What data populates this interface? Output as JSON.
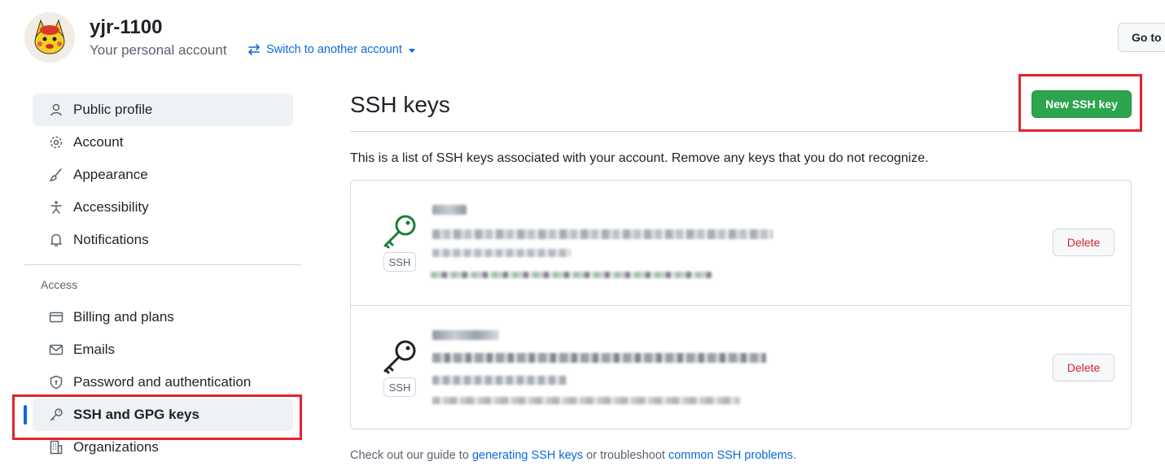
{
  "header": {
    "username": "yjr-1100",
    "subtitle": "Your personal account",
    "switch_label": "Switch to another account",
    "goto_label": "Go to"
  },
  "sidebar": {
    "items": [
      {
        "label": "Public profile",
        "icon": "person-icon"
      },
      {
        "label": "Account",
        "icon": "gear-icon"
      },
      {
        "label": "Appearance",
        "icon": "paintbrush-icon"
      },
      {
        "label": "Accessibility",
        "icon": "accessibility-icon"
      },
      {
        "label": "Notifications",
        "icon": "bell-icon"
      }
    ],
    "access_label": "Access",
    "access_items": [
      {
        "label": "Billing and plans",
        "icon": "credit-card-icon"
      },
      {
        "label": "Emails",
        "icon": "mail-icon"
      },
      {
        "label": "Password and authentication",
        "icon": "shield-lock-icon"
      },
      {
        "label": "SSH and GPG keys",
        "icon": "key-icon",
        "selected": true
      },
      {
        "label": "Organizations",
        "icon": "organization-icon"
      }
    ]
  },
  "main": {
    "title": "SSH keys",
    "new_button": "New SSH key",
    "description": "This is a list of SSH keys associated with your account. Remove any keys that you do not recognize.",
    "keys": [
      {
        "badge": "SSH",
        "delete_label": "Delete",
        "icon_color": "#1a7f37"
      },
      {
        "badge": "SSH",
        "delete_label": "Delete",
        "icon_color": "#1f2328"
      }
    ],
    "footer": {
      "prefix": "Check out our guide to ",
      "link1": "generating SSH keys",
      "middle": " or troubleshoot ",
      "link2": "common SSH problems",
      "suffix": "."
    }
  },
  "colors": {
    "accent": "#0969da",
    "primary_button": "#2da44e",
    "danger": "#d1242f",
    "highlight_box": "#e5222e"
  }
}
